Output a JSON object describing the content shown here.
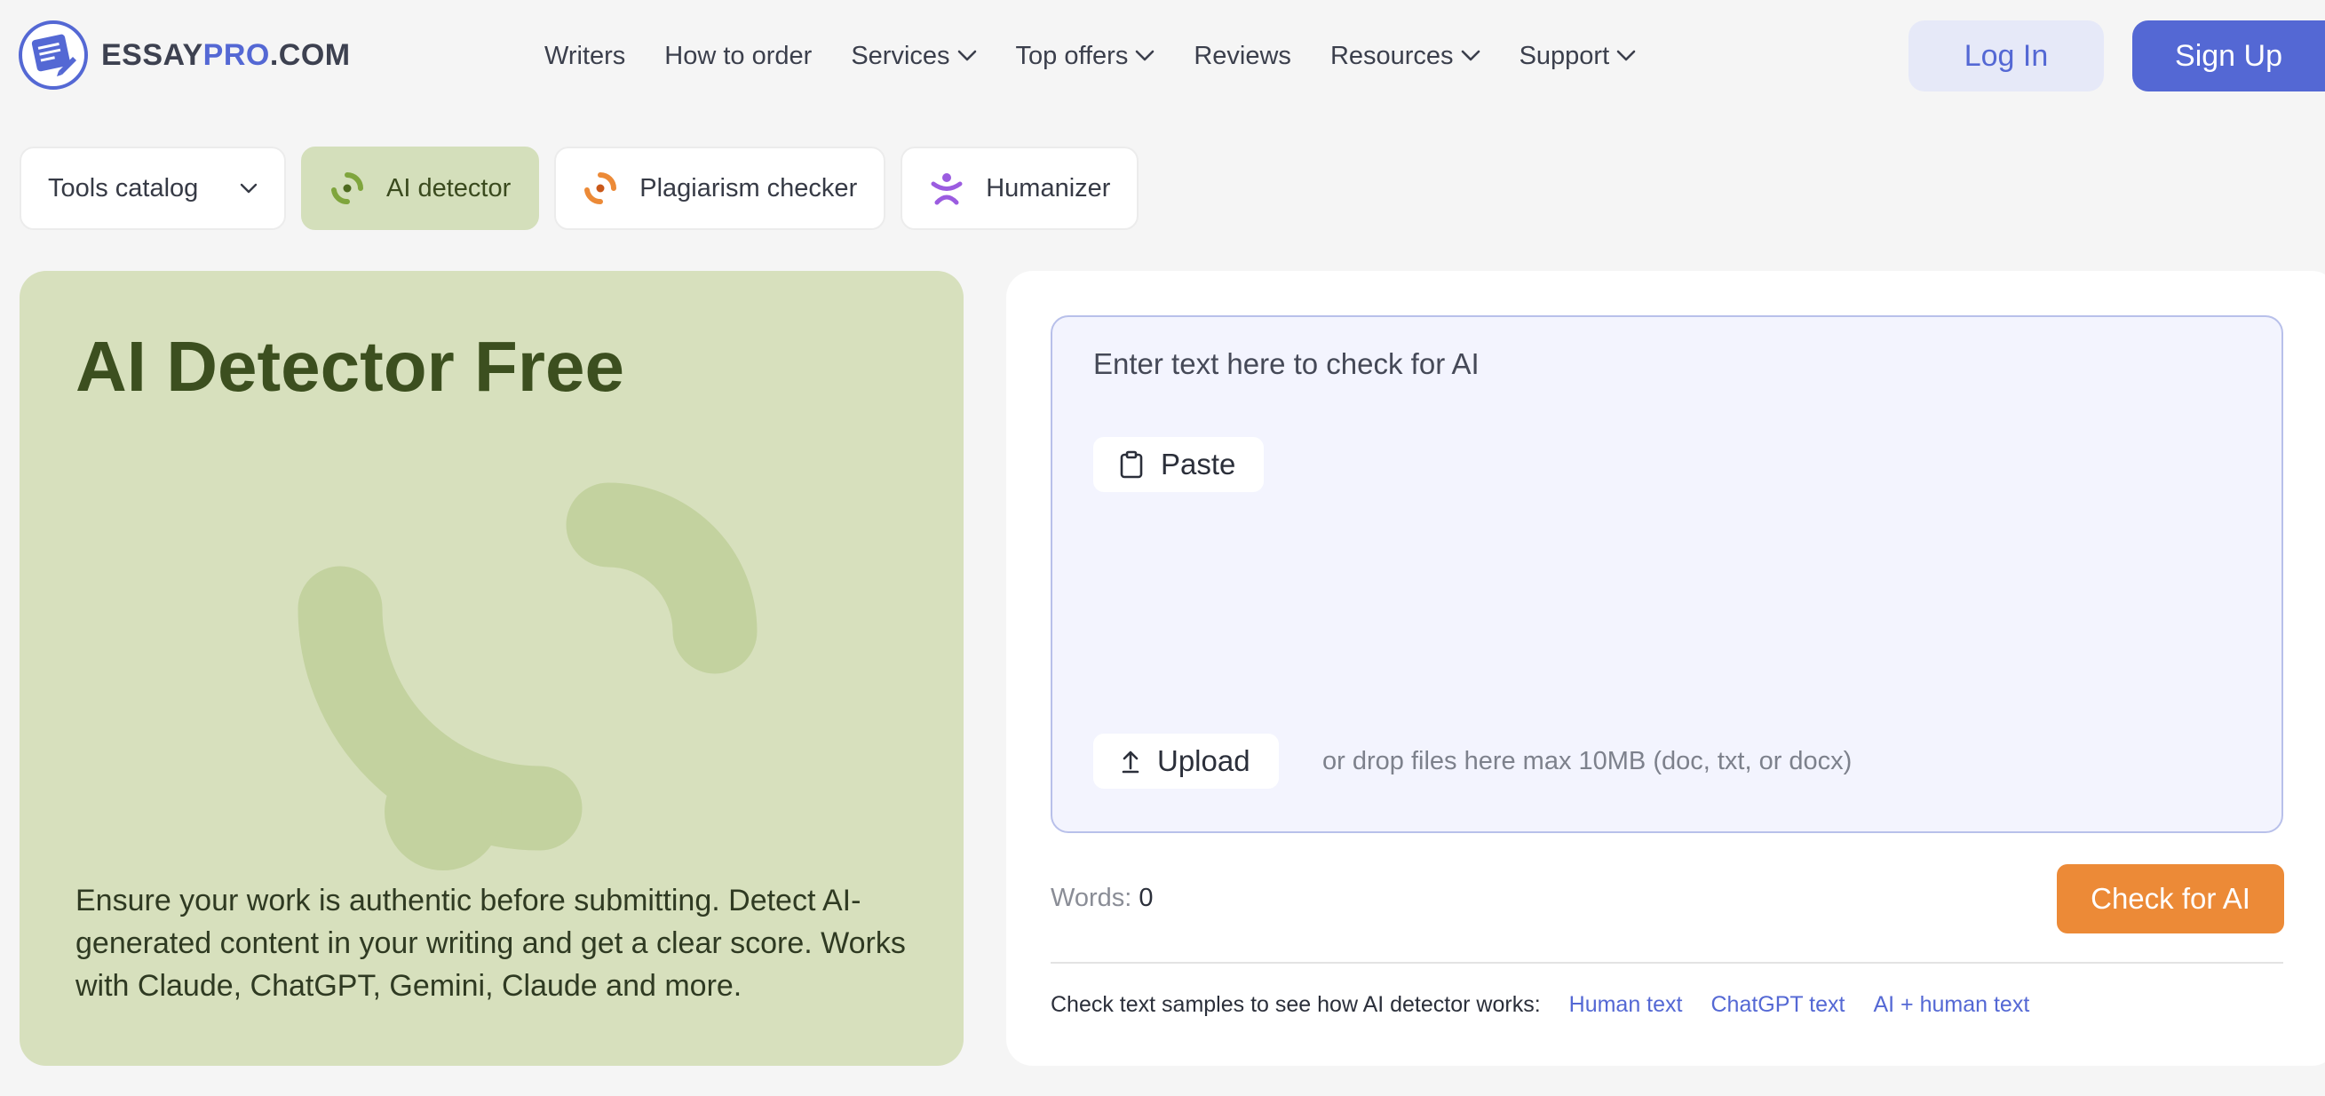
{
  "colors": {
    "brand": "#5468d4",
    "hero_bg": "#d7e0bd",
    "active_tab_bg": "#d4dfbb",
    "check_button": "#ec8a37",
    "editor_bg": "#f3f4fe"
  },
  "header": {
    "logo": {
      "text_main": "ESSAY",
      "text_accent": "PRO",
      "text_suffix": ".COM",
      "icon": "essaypro-logo-icon"
    },
    "nav": [
      {
        "label": "Writers",
        "dropdown": false
      },
      {
        "label": "How to order",
        "dropdown": false
      },
      {
        "label": "Services",
        "dropdown": true
      },
      {
        "label": "Top offers",
        "dropdown": true
      },
      {
        "label": "Reviews",
        "dropdown": false
      },
      {
        "label": "Resources",
        "dropdown": true
      },
      {
        "label": "Support",
        "dropdown": true
      }
    ],
    "login_label": "Log In",
    "signup_label": "Sign Up"
  },
  "tool_tabs": {
    "catalog_label": "Tools catalog",
    "items": [
      {
        "label": "AI detector",
        "icon": "ai-detector-icon",
        "active": true
      },
      {
        "label": "Plagiarism checker",
        "icon": "plagiarism-icon",
        "active": false
      },
      {
        "label": "Humanizer",
        "icon": "humanizer-icon",
        "active": false
      }
    ]
  },
  "hero": {
    "title": "AI Detector Free",
    "description": "Ensure your work is authentic before submitting. Detect AI-generated content in your writing and get a clear score. Works with Claude, ChatGPT, Gemini, Claude and more."
  },
  "checker": {
    "placeholder": "Enter text here to check for AI",
    "paste_label": "Paste",
    "upload_label": "Upload",
    "drop_hint": "or drop files here max 10MB (doc, txt, or docx)",
    "words_label": "Words:",
    "words_count": "0",
    "check_label": "Check for AI",
    "samples_label": "Check text samples to see how AI detector works:",
    "samples": [
      "Human text",
      "ChatGPT text",
      "AI + human text"
    ]
  }
}
